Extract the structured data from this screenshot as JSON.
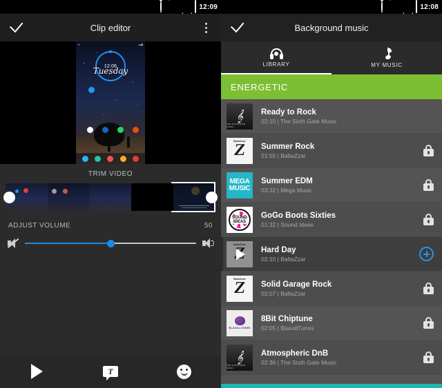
{
  "left": {
    "statusbar": {
      "notification_icon": "screenshot-icon",
      "alarm_icon": "alarm-icon",
      "wifi_icon": "wifi-icon",
      "signal_icon": "signal-icon",
      "battery_icon": "battery-icon",
      "time": "12:09"
    },
    "appbar": {
      "confirm_icon": "check-icon",
      "title": "Clip editor",
      "overflow_icon": "overflow-menu-icon"
    },
    "preview": {
      "widget_time": "12:06",
      "widget_day": "Tuesday"
    },
    "trim": {
      "label": "TRIM VIDEO",
      "handle_left": "trim-handle-left",
      "handle_right": "trim-handle-right"
    },
    "volume": {
      "label": "ADJUST VOLUME",
      "value": "50",
      "percent": 50,
      "mute_icon": "volume-mute-icon",
      "max_icon": "volume-up-icon"
    },
    "toolbar": {
      "play_icon": "play-icon",
      "text_icon": "text-tool-icon",
      "sticker_icon": "sticker-icon"
    }
  },
  "right": {
    "statusbar": {
      "alarm_icon": "alarm-icon",
      "wifi_icon": "wifi-icon",
      "signal_icon": "signal-icon",
      "battery_icon": "battery-icon",
      "time": "12:08"
    },
    "appbar": {
      "confirm_icon": "check-icon",
      "title": "Background music"
    },
    "tabs": [
      {
        "label": "LIBRARY",
        "icon": "headphones-icon",
        "active": true
      },
      {
        "label": "MY MUSIC",
        "icon": "music-note-icon",
        "active": false
      }
    ],
    "category": "ENERGETIC",
    "accent_green": "#7cbf32",
    "accent_blue": "#2196f3",
    "accent_teal": "#1bb7b0",
    "tracks": [
      {
        "title": "Ready to Rock",
        "meta": "02:10 | The Sixth Gate Music",
        "action": "none",
        "art": "gate"
      },
      {
        "title": "Summer Rock",
        "meta": "01:55 | BaltaZzar",
        "action": "lock",
        "art": "z"
      },
      {
        "title": "Summer EDM",
        "meta": "03:32 | Mega Music",
        "action": "lock",
        "art": "mega"
      },
      {
        "title": "GoGo Boots Sixties",
        "meta": "01:32 | Sound Ideas",
        "action": "lock",
        "art": "sound"
      },
      {
        "title": "Hard Day",
        "meta": "02:10 | BaltaZzar",
        "action": "add",
        "art": "z",
        "selected": true
      },
      {
        "title": "Solid Garage Rock",
        "meta": "02:07 | BaltaZzar",
        "action": "lock",
        "art": "z"
      },
      {
        "title": "8Bit Chiptune",
        "meta": "02:05 | BlaxallTunes",
        "action": "lock",
        "art": "blax"
      },
      {
        "title": "Atmospheric DnB",
        "meta": "02:36 | The Sixth Gate Music",
        "action": "lock",
        "art": "gate"
      }
    ]
  }
}
